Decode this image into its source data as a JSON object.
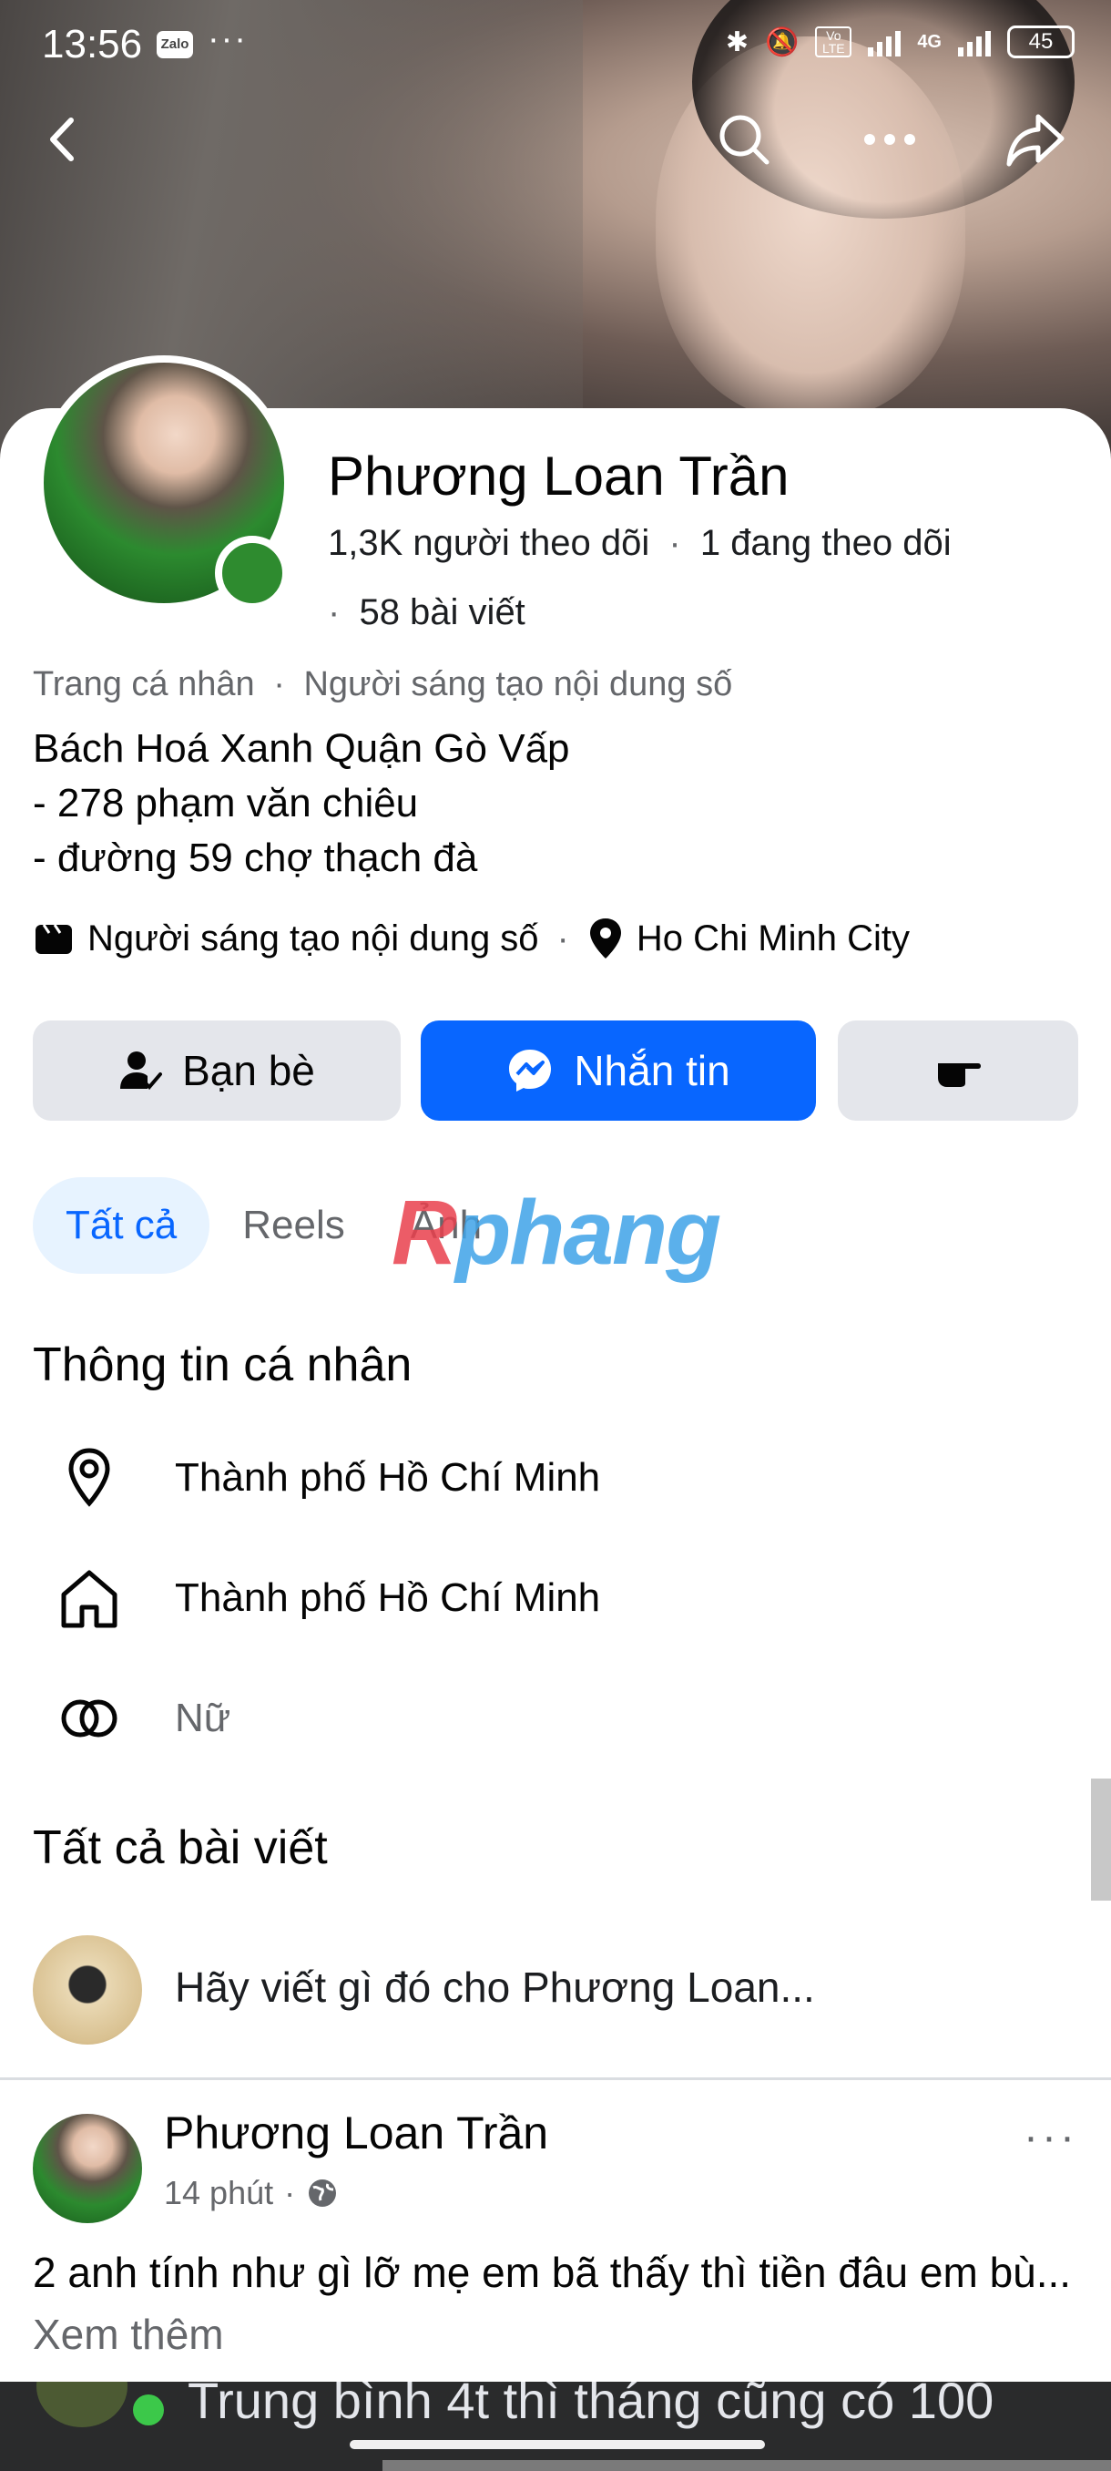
{
  "status": {
    "time": "13:56",
    "zalo": "Zalo",
    "more": "···",
    "battery": "45",
    "net": "4G",
    "volte": "Vo LTE"
  },
  "profile": {
    "name": "Phương Loan Trần",
    "followers": "1,3K người theo dõi",
    "following": "1 đang theo dõi",
    "posts": "58 bài viết",
    "category_prefix": "Trang cá nhân",
    "category": "Người sáng tạo nội dung số",
    "bio": [
      "Bách Hoá Xanh Quận Gò Vấp",
      "- 278 phạm văn chiêu",
      "- đường 59 chợ thạch đà"
    ],
    "detail_creator": "Người sáng tạo nội dung số",
    "detail_location": "Ho Chi Minh City"
  },
  "actions": {
    "friends": "Bạn bè",
    "message": "Nhắn tin"
  },
  "tabs": [
    {
      "label": "Tất cả",
      "active": true
    },
    {
      "label": "Reels"
    },
    {
      "label": "Ảnh"
    }
  ],
  "watermark": {
    "part1": "R",
    "part2": "phang"
  },
  "about": {
    "title": "Thông tin cá nhân",
    "items": [
      {
        "icon": "location-pin-icon",
        "text": "Thành phố Hồ Chí Minh"
      },
      {
        "icon": "home-icon",
        "text": "Thành phố Hồ Chí Minh"
      },
      {
        "icon": "gender-icon",
        "text": "Nữ"
      }
    ]
  },
  "posts_section": {
    "title": "Tất cả bài viết",
    "composer_placeholder": "Hãy viết gì đó cho Phương Loan..."
  },
  "post": {
    "author": "Phương Loan Trần",
    "time": "14 phút",
    "text": "2 anh tính như gì lỡ mẹ em bã thấy thì tiền đâu em bù...",
    "see_more": "Xem thêm",
    "more": "···"
  },
  "next_post_preview": "Trung bình 4t thì tháng cũng có 100",
  "colors": {
    "accent": "#0866ff",
    "online": "#2e8b2f",
    "secondary_text": "#65676b",
    "button_grey": "#e4e6eb"
  }
}
